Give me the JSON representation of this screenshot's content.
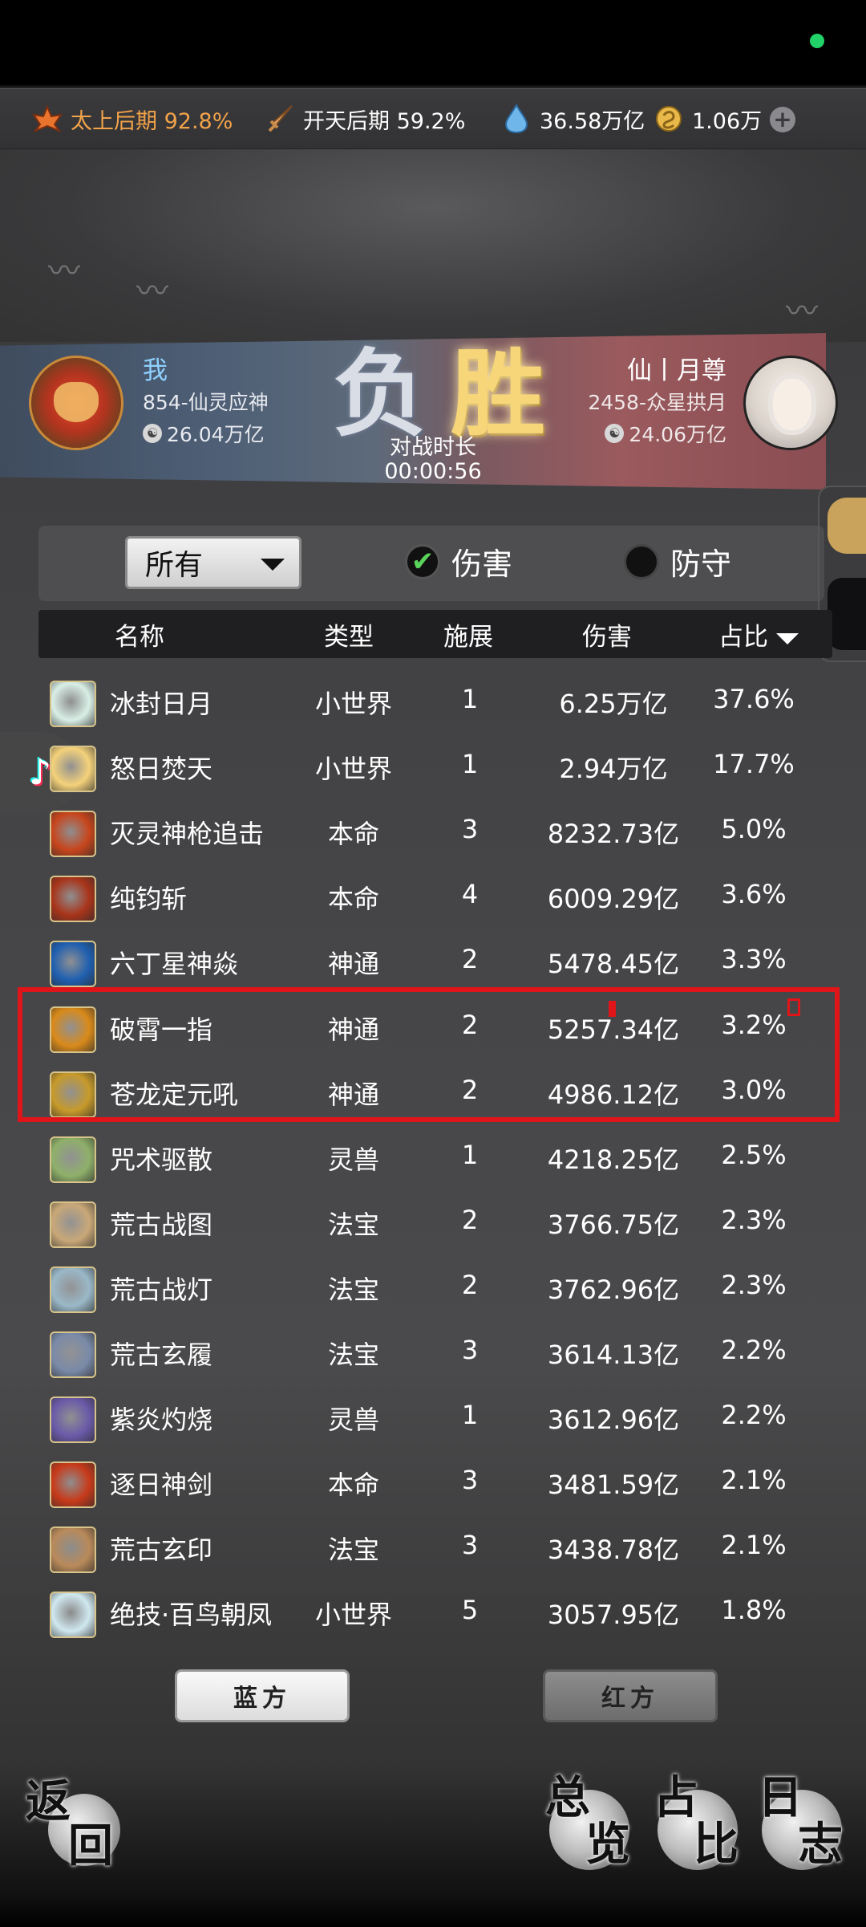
{
  "resources": {
    "realm1": "太上后期 92.8%",
    "realm2": "开天后期 59.2%",
    "spirit_stones": "36.58万亿",
    "coins": "1.06万"
  },
  "battle": {
    "me": {
      "name": "我",
      "server": "854-仙灵应神",
      "power": "26.04万亿"
    },
    "opponent": {
      "name": "仙丨月尊",
      "server": "2458-众星拱月",
      "power": "24.06万亿"
    },
    "left_result": "负",
    "right_result": "胜",
    "duration_label": "对战时长",
    "duration": "00:00:56"
  },
  "filters": {
    "dropdown_value": "所有",
    "damage_label": "伤害",
    "defense_label": "防守",
    "damage_checked": true,
    "defense_checked": false
  },
  "table": {
    "headers": {
      "name": "名称",
      "type": "类型",
      "cast": "施展",
      "damage": "伤害",
      "ratio": "占比"
    },
    "rows": [
      {
        "name": "冰封日月",
        "type": "小世界",
        "cast": "1",
        "damage": "6.25万亿",
        "ratio": "37.6%",
        "icon": "ice-lotus-icon"
      },
      {
        "name": "怒日焚天",
        "type": "小世界",
        "cast": "1",
        "damage": "2.94万亿",
        "ratio": "17.7%",
        "icon": "sun-flame-icon"
      },
      {
        "name": "灭灵神枪追击",
        "type": "本命",
        "cast": "3",
        "damage": "8232.73亿",
        "ratio": "5.0%",
        "icon": "spear-icon"
      },
      {
        "name": "纯钧斩",
        "type": "本命",
        "cast": "4",
        "damage": "6009.29亿",
        "ratio": "3.6%",
        "icon": "slash-icon"
      },
      {
        "name": "六丁星神焱",
        "type": "神通",
        "cast": "2",
        "damage": "5478.45亿",
        "ratio": "3.3%",
        "icon": "star-flame-icon"
      },
      {
        "name": "破霄一指",
        "type": "神通",
        "cast": "2",
        "damage": "5257.34亿",
        "ratio": "3.2%",
        "icon": "finger-strike-icon"
      },
      {
        "name": "苍龙定元吼",
        "type": "神通",
        "cast": "2",
        "damage": "4986.12亿",
        "ratio": "3.0%",
        "icon": "dragon-roar-icon"
      },
      {
        "name": "咒术驱散",
        "type": "灵兽",
        "cast": "1",
        "damage": "4218.25亿",
        "ratio": "2.5%",
        "icon": "beast-icon"
      },
      {
        "name": "荒古战图",
        "type": "法宝",
        "cast": "2",
        "damage": "3766.75亿",
        "ratio": "2.3%",
        "icon": "war-map-icon"
      },
      {
        "name": "荒古战灯",
        "type": "法宝",
        "cast": "2",
        "damage": "3762.96亿",
        "ratio": "2.3%",
        "icon": "war-lamp-icon"
      },
      {
        "name": "荒古玄履",
        "type": "法宝",
        "cast": "3",
        "damage": "3614.13亿",
        "ratio": "2.2%",
        "icon": "boots-icon"
      },
      {
        "name": "紫炎灼烧",
        "type": "灵兽",
        "cast": "1",
        "damage": "3612.96亿",
        "ratio": "2.2%",
        "icon": "purple-beast-icon"
      },
      {
        "name": "逐日神剑",
        "type": "本命",
        "cast": "3",
        "damage": "3481.59亿",
        "ratio": "2.1%",
        "icon": "sword-icon"
      },
      {
        "name": "荒古玄印",
        "type": "法宝",
        "cast": "3",
        "damage": "3438.78亿",
        "ratio": "2.1%",
        "icon": "seal-icon"
      },
      {
        "name": "绝技·百鸟朝凤",
        "type": "小世界",
        "cast": "5",
        "damage": "3057.95亿",
        "ratio": "1.8%",
        "icon": "phoenix-icon"
      }
    ]
  },
  "side_buttons": {
    "blue": "蓝方",
    "red": "红方"
  },
  "nav": {
    "back": [
      "返",
      "回"
    ],
    "overview": [
      "总",
      "览"
    ],
    "ratio": [
      "占",
      "比"
    ],
    "log": [
      "日",
      "志"
    ]
  },
  "colors": {
    "highlight": "#e0151a",
    "win": "#f6d678",
    "realm1": "#f3a34a",
    "status_dot": "#22d36a"
  }
}
